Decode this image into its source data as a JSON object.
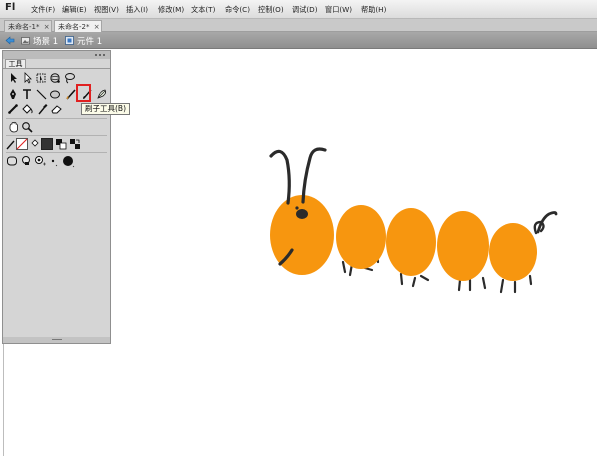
{
  "app": {
    "logo": "Fl"
  },
  "menu": {
    "items": [
      "文件(F)",
      "编辑(E)",
      "视图(V)",
      "插入(I)",
      "修改(M)",
      "文本(T)",
      "命令(C)",
      "控制(O)",
      "调试(D)",
      "窗口(W)",
      "帮助(H)"
    ]
  },
  "tabs": [
    {
      "label": "未命名-1*",
      "close": "×"
    },
    {
      "label": "未命名-2*",
      "close": "×"
    }
  ],
  "editbar": {
    "scene_label": "场景 1",
    "symbol_label": "元件 1"
  },
  "tools_panel": {
    "title": "工具",
    "tooltip": "刷子工具(B)",
    "highlighted_tool": "brush-tool",
    "stroke_color": "#333333",
    "fill_color": "#333333"
  },
  "icons": [
    "back-arrow-icon",
    "scene-icon",
    "symbol-icon",
    "selection-tool-icon",
    "subselection-tool-icon",
    "free-transform-tool-icon",
    "3d-rotation-tool-icon",
    "lasso-tool-icon",
    "pen-tool-icon",
    "text-tool-icon",
    "line-tool-icon",
    "oval-tool-icon",
    "pencil-tool-icon",
    "brush-tool-icon",
    "deco-tool-icon",
    "bone-tool-icon",
    "paint-bucket-tool-icon",
    "eyedropper-tool-icon",
    "eraser-tool-icon",
    "hand-tool-icon",
    "zoom-tool-icon"
  ],
  "colors": {
    "caterpillar_body": "#F7960F",
    "caterpillar_lines": "#2B2B2B"
  }
}
